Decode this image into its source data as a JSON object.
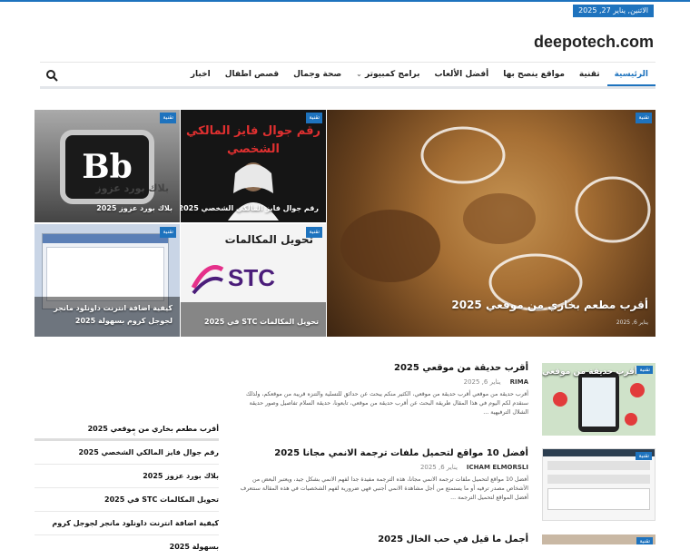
{
  "site": {
    "logo": "deepotech.com",
    "date": "الاثنين, يناير 27, 2025"
  },
  "nav": {
    "items": [
      "الرئيسية",
      "تقنية",
      "مواقع ينصح بها",
      "أفضل الألعاب",
      "برامج كمبيوتر",
      "صحة وجمال",
      "قصص اطفال",
      "اخبار"
    ],
    "dropdown_glyph": "⌄"
  },
  "featured": {
    "big": {
      "badge": "تقنية",
      "caption": "أقرب مطعم بخاري من موقعي 2025",
      "meta": "يناير 6, 2025"
    },
    "t1": {
      "badge": "تقنية",
      "caption": "رقم جوال فايز المالكي الشخصي 2025",
      "art": "رقم جوال فايز المالكي الشخصي"
    },
    "t2": {
      "badge": "تقنية",
      "caption": "بلاك بورد عزوز 2025",
      "art": "Bb",
      "art2": "بلاك بورد عزوز"
    },
    "t3": {
      "badge": "تقنية",
      "caption": "تحويل المكالمات STC في 2025",
      "art": "تحويل المكالمات",
      "art2": "STC"
    },
    "t4": {
      "badge": "تقنية",
      "caption": "كيفية اضافة انترنت داونلود مانجر لجوجل كروم بسهولة 2025"
    }
  },
  "posts": [
    {
      "title": "أقرب حديقة من موقعي 2025",
      "author": "RIMA",
      "date": "يناير 6, 2025",
      "excerpt": "أقرب حديقة من موقعي أقرب حديقة من موقعي، الكثير منكم يبحث عن حدائق للتسلية والتنزه قريبة من موقعكم، ولذلك سنقدم لكم اليوم في هذا المقال طريقة البحث عن أقرب حديقة من موقعي، تابعونا، حديقة السلام تفاصيل وصور حديقة الشلال الترفيهية ..."
    },
    {
      "title": "أفضل 10 مواقع لتحميل ملفات ترجمة الانمي مجانا 2025",
      "author": "ICHAM ELMORSLI",
      "date": "يناير 6, 2025",
      "excerpt": "أفضل 10 مواقع لتحميل ملفات ترجمة الانمي مجانا، هذه الترجمة مفيدة جدا لفهم الانمي بشكل جيد، ويعتبر البعض من الأشخاص مصدر ترفيه أو ما يستمتع من أجل مشاهدة الانمي أجنبي فهي ضرورية لفهم الشخصيات في هذه المقالة سنتعرف أفضل المواقع لتحميل الترجمة ..."
    },
    {
      "title": "أجمل ما قيل في حب الخال 2025",
      "author": "",
      "date": "",
      "excerpt": ""
    }
  ],
  "sidebar_links": [
    "أقرب مطعم بخاري من موقعي 2025",
    "رقم جوال فايز المالكي الشخصي 2025",
    "بلاك بورد عزوز 2025",
    "تحويل المكالمات STC في 2025",
    "كيفية اضافة انترنت داونلود مانجر لجوجل كروم بسهولة 2025"
  ],
  "thumbs": [
    {
      "badge": "تقنية",
      "art": "أقرب حديقة من موقعي"
    },
    {
      "badge": "تقنية"
    },
    {
      "badge": "تقنية"
    }
  ],
  "colors": {
    "accent": "#1e73be"
  }
}
